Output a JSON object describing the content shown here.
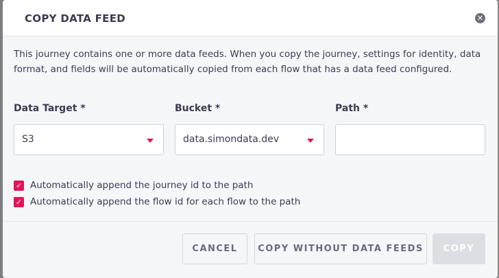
{
  "dialog": {
    "title": "COPY DATA FEED",
    "close_icon": "close-circle-icon",
    "description": "This journey contains one or more data feeds. When you copy the journey, settings for identity, data format, and fields will be automatically copied from each flow that has a data feed configured."
  },
  "fields": {
    "data_target": {
      "label": "Data Target *",
      "value": "S3"
    },
    "bucket": {
      "label": "Bucket *",
      "value": "data.simondata.dev"
    },
    "path": {
      "label": "Path *",
      "value": "",
      "placeholder": ""
    }
  },
  "options": [
    {
      "label": "Automatically append the journey id to the path",
      "checked": true
    },
    {
      "label": "Automatically append the flow id for each flow to the path",
      "checked": true
    }
  ],
  "buttons": {
    "cancel": "CANCEL",
    "copy_without": "COPY WITHOUT DATA FEEDS",
    "copy": "COPY"
  },
  "colors": {
    "accent": "#e0145a",
    "text": "#3d3a52",
    "disabled_button": "#dcdee4"
  }
}
